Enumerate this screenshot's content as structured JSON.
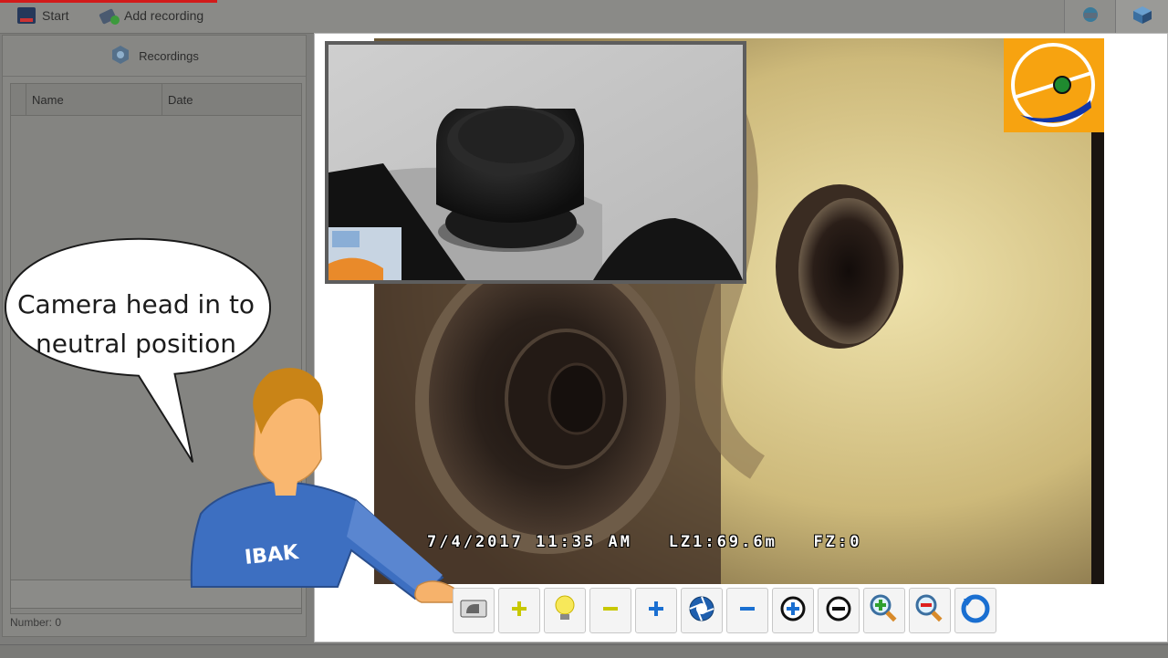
{
  "toolbar": {
    "start_label": "Start",
    "add_recording_label": "Add recording"
  },
  "recordings": {
    "header_label": "Recordings",
    "columns": [
      "Name",
      "Date"
    ],
    "number_label": "Number: 0"
  },
  "video": {
    "osd_text": "7/4/2017 11:35 AM   LZ1:69.6m   FZ:0"
  },
  "callout": {
    "line1": "Camera head in to",
    "line2": "neutral position",
    "badge": "IBAK"
  },
  "controls": [
    {
      "name": "neutral-position-button",
      "icon": "camera-head-icon"
    },
    {
      "name": "light-increase-button",
      "icon": "plus-icon",
      "color": "#c8c800"
    },
    {
      "name": "light-button",
      "icon": "bulb-icon"
    },
    {
      "name": "light-decrease-button",
      "icon": "minus-icon",
      "color": "#c8c800"
    },
    {
      "name": "aperture-increase-button",
      "icon": "plus-icon",
      "color": "#1a6fd1"
    },
    {
      "name": "aperture-button",
      "icon": "aperture-icon"
    },
    {
      "name": "aperture-decrease-button",
      "icon": "minus-icon",
      "color": "#1a6fd1"
    },
    {
      "name": "focus-in-button",
      "icon": "focus-plus-icon"
    },
    {
      "name": "focus-out-button",
      "icon": "focus-minus-icon"
    },
    {
      "name": "zoom-in-button",
      "icon": "zoom-in-icon"
    },
    {
      "name": "zoom-out-button",
      "icon": "zoom-out-icon"
    },
    {
      "name": "rotate-button",
      "icon": "rotate-icon"
    }
  ],
  "colors": {
    "logo_bg": "#f7a310",
    "accent_blue": "#1a6fd1",
    "accent_yellow": "#c8c800"
  }
}
